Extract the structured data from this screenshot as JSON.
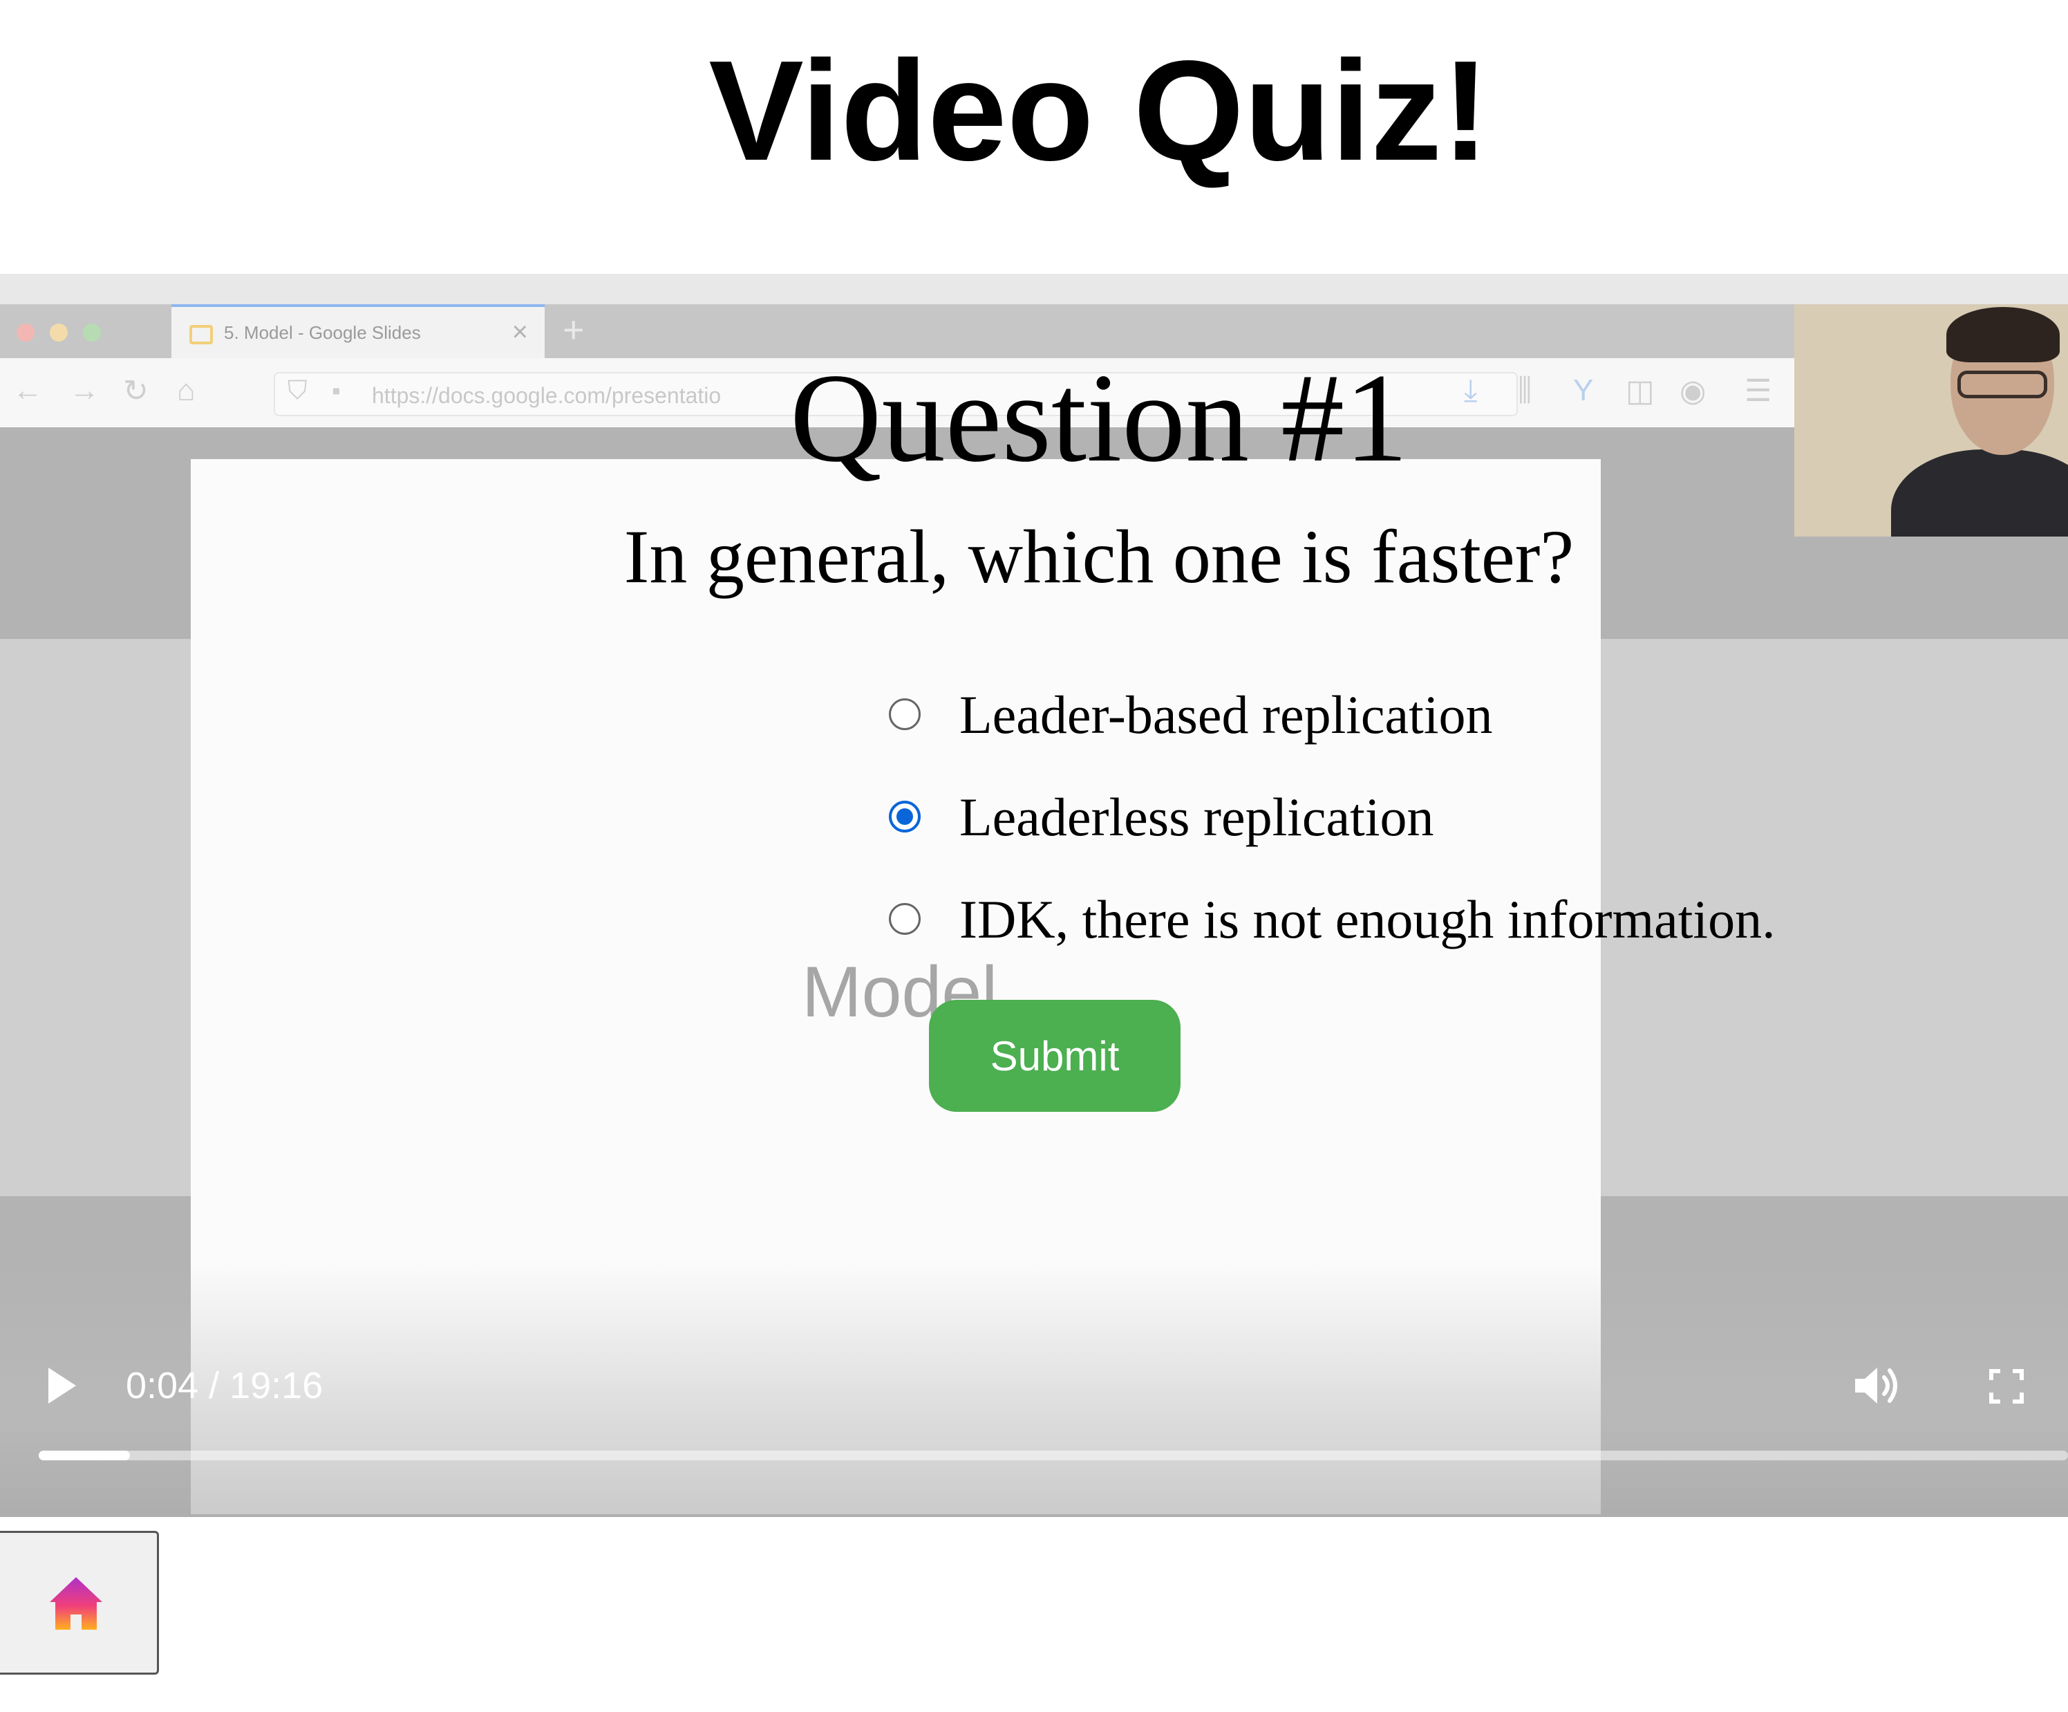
{
  "page": {
    "title": "Video Quiz!"
  },
  "video": {
    "browser_tab_title": "5. Model - Google Slides",
    "url": "https://docs.google.com/presentatio",
    "slide_watermark": "Model",
    "time_display": "0:04 / 19:16",
    "progress_fraction": 0.045
  },
  "quiz": {
    "title": "Question #1",
    "question": "In general, which one is faster?",
    "options": [
      {
        "label": "Leader-based replication",
        "selected": false
      },
      {
        "label": "Leaderless replication",
        "selected": true
      },
      {
        "label": "IDK, there is not enough information.",
        "selected": false
      }
    ],
    "submit_label": "Submit"
  },
  "colors": {
    "submit": "#4caf50",
    "radio_selected": "#0a66d8"
  },
  "icons": {
    "play": "play-icon",
    "volume": "volume-icon",
    "fullscreen": "fullscreen-icon",
    "home": "home-icon"
  }
}
